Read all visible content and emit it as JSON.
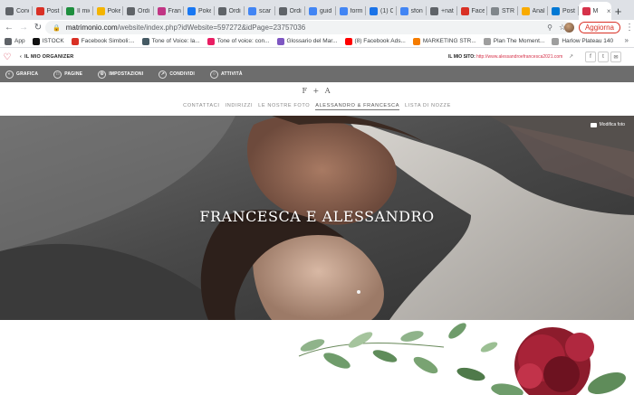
{
  "browser": {
    "tabs": [
      {
        "label": "Cond",
        "icon": "gear-icon",
        "color": "#5f6368"
      },
      {
        "label": "Post",
        "icon": "gmail-icon",
        "color": "#d93025"
      },
      {
        "label": "Il mio",
        "icon": "drive-icon",
        "color": "#1e8e3e"
      },
      {
        "label": "Poke",
        "icon": "slides-icon",
        "color": "#f4b400"
      },
      {
        "label": "Ordi",
        "icon": "globe-icon",
        "color": "#5f6368"
      },
      {
        "label": "Fran",
        "icon": "instagram-icon",
        "color": "#c13584"
      },
      {
        "label": "Poke",
        "icon": "facebook-icon",
        "color": "#1877f2"
      },
      {
        "label": "Ordi",
        "icon": "globe-icon",
        "color": "#5f6368"
      },
      {
        "label": "scar",
        "icon": "google-icon",
        "color": "#4285f4"
      },
      {
        "label": "Ordi",
        "icon": "globe-icon",
        "color": "#5f6368"
      },
      {
        "label": "guid",
        "icon": "google-icon",
        "color": "#4285f4"
      },
      {
        "label": "form",
        "icon": "google-icon",
        "color": "#4285f4"
      },
      {
        "label": "(1) C",
        "icon": "calendar-icon",
        "color": "#1a73e8"
      },
      {
        "label": "sfon",
        "icon": "google-icon",
        "color": "#4285f4"
      },
      {
        "label": "+nat",
        "icon": "globe-icon",
        "color": "#5f6368"
      },
      {
        "label": "Face",
        "icon": "facebook-icon",
        "color": "#d93025"
      },
      {
        "label": "STR",
        "icon": "doc-icon",
        "color": "#80868b"
      },
      {
        "label": "Anal",
        "icon": "analytics-icon",
        "color": "#f9ab00"
      },
      {
        "label": "Post",
        "icon": "outlook-icon",
        "color": "#0078d4"
      },
      {
        "label": "M",
        "icon": "heart-icon",
        "color": "#d6324a",
        "active": true
      }
    ],
    "url_host": "matrimonio.com",
    "url_path": "/website/index.php?idWebsite=597272&idPage=23757036",
    "update_label": "Aggiorna",
    "bookmarks": [
      {
        "label": "App",
        "icon": "apps-grid-icon",
        "color": "#5f6368"
      },
      {
        "label": "ISTOCK",
        "icon": "istock-icon",
        "color": "#111111"
      },
      {
        "label": "Facebook Simboli:...",
        "icon": "bookmark-icon",
        "color": "#d93025"
      },
      {
        "label": "Tone of Voice: la...",
        "icon": "bookmark-icon",
        "color": "#455a64"
      },
      {
        "label": "Tone of voice: con...",
        "icon": "bookmark-icon",
        "color": "#e91e63"
      },
      {
        "label": "Glossario del Mar...",
        "icon": "bookmark-icon",
        "color": "#7e57c2"
      },
      {
        "label": "(8) Facebook Ads...",
        "icon": "youtube-icon",
        "color": "#ff0000"
      },
      {
        "label": "MARKETING STR...",
        "icon": "bookmark-icon",
        "color": "#f57c00"
      },
      {
        "label": "Plan The Moment...",
        "icon": "bookmark-icon",
        "color": "#9e9e9e"
      },
      {
        "label": "Harlow Plateau 140",
        "icon": "bookmark-icon",
        "color": "#9e9e9e"
      }
    ]
  },
  "organizer": {
    "back_label": "IL MIO ORGANIZER",
    "site_label": "IL MIO SITO:",
    "site_url": "http://www.alessandroefrancesca2021.com",
    "menu": [
      {
        "label": "GRAFICA",
        "icon": "palette-icon"
      },
      {
        "label": "PAGINE",
        "icon": "pages-icon"
      },
      {
        "label": "IMPOSTAZIONI",
        "icon": "settings-icon"
      },
      {
        "label": "CONDIVIDI",
        "icon": "share-icon"
      },
      {
        "label": "ATTIVITÀ",
        "icon": "user-icon"
      }
    ]
  },
  "website": {
    "monogram": "F + A",
    "nav": [
      {
        "label": "CONTATTACI"
      },
      {
        "label": "INDIRIZZI"
      },
      {
        "label": "LE NOSTRE FOTO"
      },
      {
        "label": "ALESSANDRO & FRANCESCA",
        "active": true
      },
      {
        "label": "LISTA DI NOZZE"
      }
    ],
    "hero_title": "FRANCESCA E ALESSANDRO",
    "edit_photo_label": "Modifica foto"
  }
}
